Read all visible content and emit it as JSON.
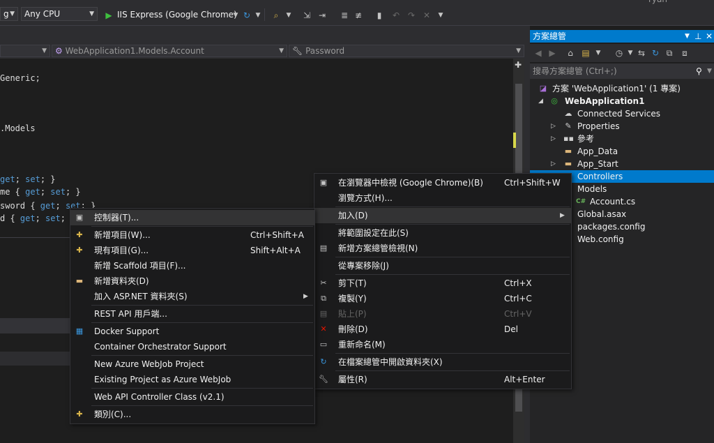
{
  "toolbar": {
    "debug_combo": "g",
    "platform_combo": "Any CPU",
    "run_target": "IIS Express (Google Chrome)",
    "user_name_partial": "ryan"
  },
  "navbar": {
    "type_combo": "WebApplication1.Models.Account",
    "member_combo": "Password"
  },
  "code": {
    "line1": "Generic;",
    "line2": ".Models",
    "line3a": "get",
    "line3b": "; ",
    "line3c": "set",
    "line3d": "; }",
    "line4a": "me { ",
    "line4b": "get",
    "line4c": "; ",
    "line4d": "set",
    "line4e": "; }",
    "line5a": "sword { ",
    "line5b": "get",
    "line5c": "; ",
    "line5d": "set",
    "line5e": "; }",
    "line6a": "d { ",
    "line6b": "get",
    "line6c": "; ",
    "line6d": "set",
    "line6e": ";"
  },
  "solution_explorer": {
    "title": "方案總管",
    "search_placeholder": "搜尋方案總管 (Ctrl+;)",
    "tree": [
      {
        "label": "方案 'WebApplication1' (1 專案)",
        "icon": "solution-icon"
      },
      {
        "label": "WebApplication1",
        "icon": "web-project-icon"
      },
      {
        "label": "Connected Services",
        "icon": "cloud-icon"
      },
      {
        "label": "Properties",
        "icon": "wrench-icon"
      },
      {
        "label": "參考",
        "icon": "references-icon"
      },
      {
        "label": "App_Data",
        "icon": "folder-icon"
      },
      {
        "label": "App_Start",
        "icon": "folder-icon"
      },
      {
        "label": "Controllers",
        "icon": "folder-icon"
      },
      {
        "label": "Models",
        "icon": "folder-icon"
      },
      {
        "label": "Account.cs",
        "icon": "csharp-file-icon"
      },
      {
        "label": "Global.asax",
        "icon": "file-icon"
      },
      {
        "label": "packages.config",
        "icon": "config-icon"
      },
      {
        "label": "Web.config",
        "icon": "config-icon"
      }
    ]
  },
  "context_menu": {
    "items": [
      {
        "label": "在瀏覽器中檢視 (Google Chrome)(B)",
        "shortcut": "Ctrl+Shift+W",
        "icon": "browser-icon"
      },
      {
        "label": "瀏覽方式(H)...",
        "shortcut": "",
        "icon": ""
      },
      {
        "label": "加入(D)",
        "shortcut": "",
        "icon": ""
      },
      {
        "label": "將範圍設定在此(S)",
        "shortcut": "",
        "icon": ""
      },
      {
        "label": "新增方案總管檢視(N)",
        "shortcut": "",
        "icon": "new-view-icon"
      },
      {
        "label": "從專案移除(J)",
        "shortcut": "",
        "icon": ""
      },
      {
        "label": "剪下(T)",
        "shortcut": "Ctrl+X",
        "icon": "cut-icon"
      },
      {
        "label": "複製(Y)",
        "shortcut": "Ctrl+C",
        "icon": "copy-icon"
      },
      {
        "label": "貼上(P)",
        "shortcut": "Ctrl+V",
        "icon": "paste-icon"
      },
      {
        "label": "刪除(D)",
        "shortcut": "Del",
        "icon": "delete-icon"
      },
      {
        "label": "重新命名(M)",
        "shortcut": "",
        "icon": "rename-icon"
      },
      {
        "label": "在檔案總管中開啟資料夾(X)",
        "shortcut": "",
        "icon": "refresh-arrow-icon"
      },
      {
        "label": "屬性(R)",
        "shortcut": "Alt+Enter",
        "icon": "wrench-icon"
      }
    ]
  },
  "add_submenu": {
    "items": [
      {
        "label": "控制器(T)...",
        "shortcut": "",
        "icon": "controller-icon"
      },
      {
        "label": "新增項目(W)...",
        "shortcut": "Ctrl+Shift+A",
        "icon": "new-item-icon"
      },
      {
        "label": "現有項目(G)...",
        "shortcut": "Shift+Alt+A",
        "icon": "existing-item-icon"
      },
      {
        "label": "新增 Scaffold 項目(F)...",
        "shortcut": "",
        "icon": ""
      },
      {
        "label": "新增資料夾(D)",
        "shortcut": "",
        "icon": "new-folder-icon"
      },
      {
        "label": "加入 ASP.NET 資料夾(S)",
        "shortcut": "",
        "icon": ""
      },
      {
        "label": "REST API 用戶端...",
        "shortcut": "",
        "icon": ""
      },
      {
        "label": "Docker Support",
        "shortcut": "",
        "icon": "docker-icon"
      },
      {
        "label": "Container Orchestrator Support",
        "shortcut": "",
        "icon": ""
      },
      {
        "label": "New Azure WebJob Project",
        "shortcut": "",
        "icon": ""
      },
      {
        "label": "Existing Project as Azure WebJob",
        "shortcut": "",
        "icon": ""
      },
      {
        "label": "Web API Controller Class (v2.1)",
        "shortcut": "",
        "icon": ""
      },
      {
        "label": "類別(C)...",
        "shortcut": "",
        "icon": "class-icon"
      }
    ]
  },
  "colors": {
    "accent": "#007acc",
    "menu_bg": "#1b1b1c",
    "editor_bg": "#1e1e1e",
    "keyword": "#569cd6",
    "delete_red": "#e51400"
  }
}
